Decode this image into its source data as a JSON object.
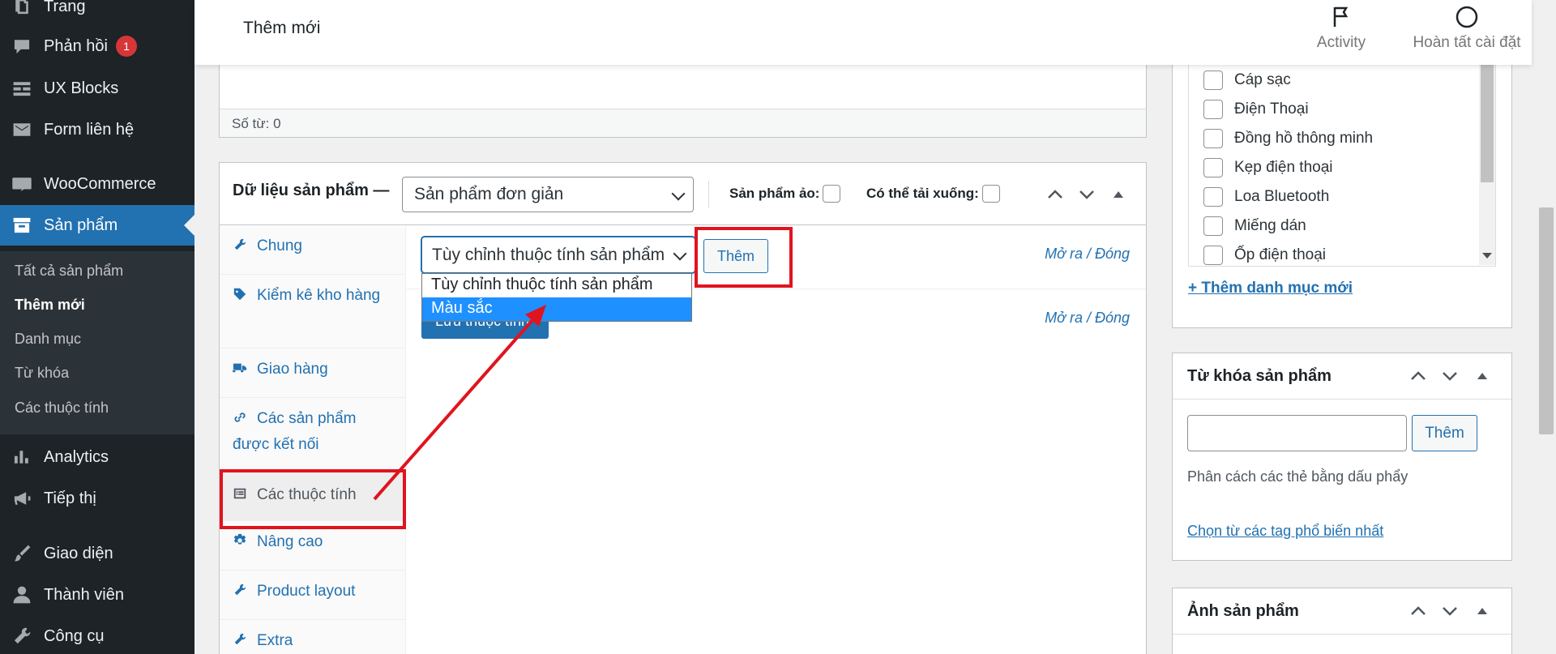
{
  "sidebar": {
    "items": [
      {
        "label": "Trang",
        "icon": "page-icon"
      },
      {
        "label": "Phản hồi",
        "icon": "comment-icon",
        "badge": "1"
      },
      {
        "label": "UX Blocks",
        "icon": "blocks-icon"
      },
      {
        "label": "Form liên hệ",
        "icon": "mail-icon"
      },
      {
        "label": "WooCommerce",
        "icon": "woocommerce-icon"
      },
      {
        "label": "Sản phẩm",
        "icon": "archive-icon"
      },
      {
        "label": "Analytics",
        "icon": "bar-chart-icon"
      },
      {
        "label": "Tiếp thị",
        "icon": "megaphone-icon"
      },
      {
        "label": "Giao diện",
        "icon": "brush-icon"
      },
      {
        "label": "Thành viên",
        "icon": "user-icon"
      },
      {
        "label": "Công cụ",
        "icon": "wrench-icon"
      }
    ],
    "submenu": [
      "Tất cả sản phẩm",
      "Thêm mới",
      "Danh mục",
      "Từ khóa",
      "Các thuộc tính"
    ]
  },
  "topbar": {
    "title": "Thêm mới",
    "activity_label": "Activity",
    "setup_label": "Hoàn tất cài đặt"
  },
  "editor": {
    "word_count": "Số từ: 0"
  },
  "product_data": {
    "title": "Dữ liệu sản phẩm —",
    "type_value": "Sản phẩm đơn giản",
    "virtual_label": "Sản phẩm ảo:",
    "downloadable_label": "Có thể tải xuống:",
    "tabs": [
      {
        "label": "Chung",
        "icon": "wrench-icon"
      },
      {
        "label": "Kiểm kê kho hàng",
        "icon": "tag-icon"
      },
      {
        "label": "Giao hàng",
        "icon": "truck-icon"
      },
      {
        "label": "Các sản phẩm được kết nối",
        "icon": "link-icon"
      },
      {
        "label": "Các thuộc tính",
        "icon": "list-icon"
      },
      {
        "label": "Nâng cao",
        "icon": "gear-icon"
      },
      {
        "label": "Product layout",
        "icon": "wrench-icon"
      },
      {
        "label": "Extra",
        "icon": "wrench-icon"
      }
    ],
    "attribute_select_value": "Tùy chỉnh thuộc tính sản phẩm",
    "attribute_options": [
      "Tùy chỉnh thuộc tính sản phẩm",
      "Màu sắc"
    ],
    "add_button": "Thêm",
    "expand_collapse": "Mở ra / Đóng",
    "save_attributes_button": "Lưu thuộc tính"
  },
  "categories": {
    "items": [
      "Cáp sạc",
      "Điện Thoại",
      "Đồng hồ thông minh",
      "Kẹp điện thoại",
      "Loa Bluetooth",
      "Miếng dán",
      "Ốp điện thoại"
    ],
    "add_new_link": "+ Thêm danh mục mới"
  },
  "tags_box": {
    "title": "Từ khóa sản phẩm",
    "input_value": "",
    "add_button": "Thêm",
    "hint": "Phân cách các thẻ bằng dấu phẩy",
    "popular_link": "Chọn từ các tag phổ biến nhất"
  },
  "image_box": {
    "title": "Ảnh sản phẩm"
  },
  "colors": {
    "sidebar_bg": "#1d2327",
    "accent": "#2271b1",
    "highlight": "#e0141e",
    "badge": "#d63638"
  }
}
